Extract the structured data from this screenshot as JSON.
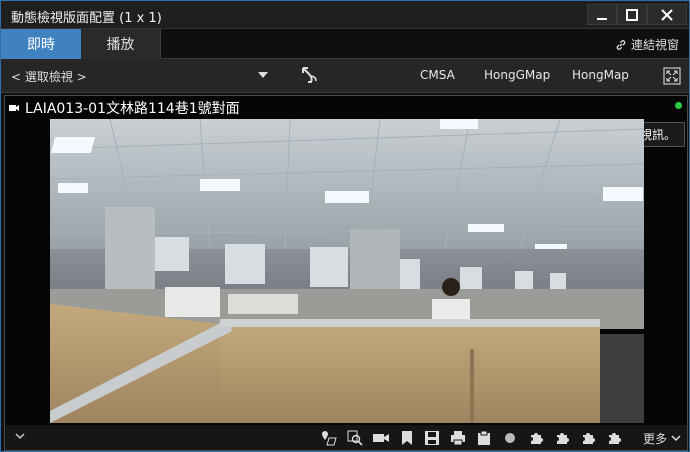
{
  "window": {
    "title": "動態檢視版面配置 (1 x 1)"
  },
  "tabs": [
    {
      "label": "即時",
      "active": true
    },
    {
      "label": "播放",
      "active": false
    }
  ],
  "header": {
    "link_window_label": "連結視窗"
  },
  "toolbar": {
    "view_select_label": "< 選取檢視 >",
    "views": [
      "CMSA",
      "HongGMap",
      "HongMap"
    ]
  },
  "camera": {
    "name": "LAIA013-01文林路114巷1號對面",
    "status_color": "#2ecc40",
    "tooltip": "正在顯示即時視訊。"
  },
  "bottom_tools": [
    "map-pin-icon",
    "zoom-search-icon",
    "camera-icon",
    "bookmark-icon",
    "save-icon",
    "print-icon",
    "clipboard-icon",
    "record-dot-icon",
    "puzzle-icon",
    "puzzle-icon",
    "puzzle-icon",
    "puzzle-icon"
  ],
  "bottom": {
    "more_label": "更多"
  },
  "colors": {
    "accent": "#3f82bf",
    "frame": "#2f6ea6"
  }
}
